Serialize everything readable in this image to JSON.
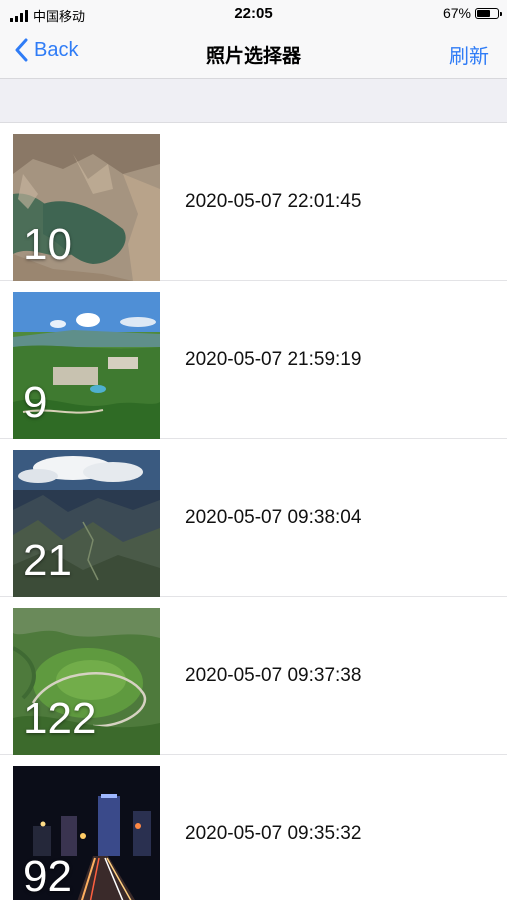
{
  "status_bar": {
    "carrier": "中国移动",
    "time": "22:05",
    "battery": "67%",
    "battery_level": 0.67
  },
  "nav": {
    "back_label": "Back",
    "title": "照片选择器",
    "refresh_label": "刷新"
  },
  "colors": {
    "accent": "#2f7cf6",
    "section_bg": "#efeff4"
  },
  "photos": [
    {
      "count": "10",
      "date": "2020-05-07 22:01:45",
      "scene": "canyon-lake"
    },
    {
      "count": "9",
      "date": "2020-05-07 21:59:19",
      "scene": "resort-valley"
    },
    {
      "count": "21",
      "date": "2020-05-07 09:38:04",
      "scene": "mountain-clouds"
    },
    {
      "count": "122",
      "date": "2020-05-07 09:37:38",
      "scene": "green-hills-road"
    },
    {
      "count": "92",
      "date": "2020-05-07 09:35:32",
      "scene": "city-night"
    }
  ]
}
